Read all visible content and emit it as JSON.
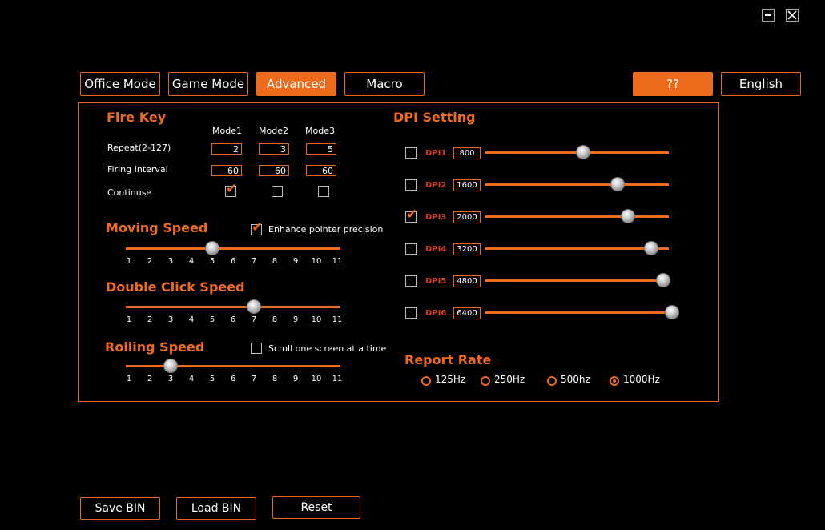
{
  "window": {
    "minimize_icon": "minimize-icon",
    "close_icon": "close-icon"
  },
  "tabs": [
    {
      "label": "Office Mode",
      "active": false
    },
    {
      "label": "Game Mode",
      "active": false
    },
    {
      "label": "Advanced",
      "active": true
    },
    {
      "label": "Macro",
      "active": false
    }
  ],
  "top_right": {
    "help_label": "??",
    "language_label": "English"
  },
  "fire_key": {
    "title": "Fire Key",
    "columns": [
      "Mode1",
      "Mode2",
      "Mode3"
    ],
    "repeat_label": "Repeat(2-127)",
    "repeat_values": [
      "2",
      "3",
      "5"
    ],
    "interval_label": "Firing Interval",
    "interval_values": [
      "60",
      "60",
      "60"
    ],
    "continue_label": "Continuse",
    "continue_checked": [
      true,
      false,
      false
    ]
  },
  "moving_speed": {
    "title": "Moving Speed",
    "enhance_label": "Enhance pointer precision",
    "enhance_checked": true,
    "ticks": [
      "1",
      "2",
      "3",
      "4",
      "5",
      "6",
      "7",
      "8",
      "9",
      "10",
      "11"
    ],
    "value": 5
  },
  "double_click": {
    "title": "Double Click Speed",
    "ticks": [
      "1",
      "2",
      "3",
      "4",
      "5",
      "6",
      "7",
      "8",
      "9",
      "10",
      "11"
    ],
    "value": 7
  },
  "rolling_speed": {
    "title": "Rolling Speed",
    "scroll_label": "Scroll one screen at a time",
    "scroll_checked": false,
    "ticks": [
      "1",
      "2",
      "3",
      "4",
      "5",
      "6",
      "7",
      "8",
      "9",
      "10",
      "11"
    ],
    "value": 3
  },
  "dpi": {
    "title": "DPI Setting",
    "levels": [
      {
        "label": "DPI1",
        "value": "800",
        "checked": false,
        "fraction": 0.31
      },
      {
        "label": "DPI2",
        "value": "1600",
        "checked": false,
        "fraction": 0.58
      },
      {
        "label": "DPI3",
        "value": "2000",
        "checked": true,
        "fraction": 0.66
      },
      {
        "label": "DPI4",
        "value": "3200",
        "checked": false,
        "fraction": 0.84
      },
      {
        "label": "DPI5",
        "value": "4800",
        "checked": false,
        "fraction": 0.93
      },
      {
        "label": "DPI6",
        "value": "6400",
        "checked": false,
        "fraction": 1.0
      }
    ]
  },
  "report_rate": {
    "title": "Report Rate",
    "options": [
      {
        "label": "125Hz",
        "selected": false
      },
      {
        "label": "250Hz",
        "selected": false
      },
      {
        "label": "500hz",
        "selected": false
      },
      {
        "label": "1000Hz",
        "selected": true
      }
    ]
  },
  "bottom": {
    "save_label": "Save BIN",
    "load_label": "Load BIN",
    "reset_label": "Reset"
  },
  "colors": {
    "accent": "#ee6a1c",
    "dpi_label": "#d63a1c",
    "background": "#000000"
  }
}
